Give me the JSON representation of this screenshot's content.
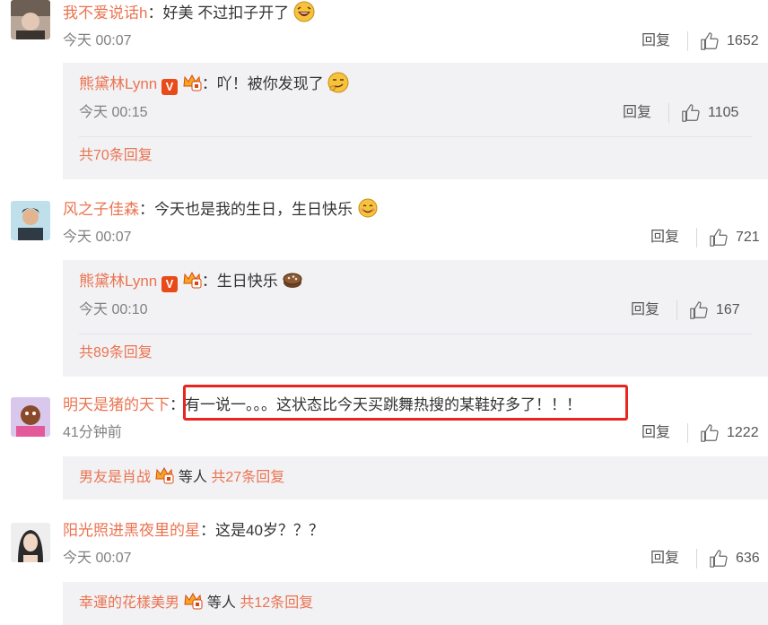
{
  "comments": [
    {
      "name": "我不爱说话h",
      "text": "好美 不过扣子开了",
      "time": "今天 00:07",
      "reply_label": "回复",
      "likes": "1652",
      "sub_reply": {
        "name": "熊黛林Lynn",
        "text": "吖！被你发现了",
        "time": "今天 00:15",
        "reply_label": "回复",
        "likes": "1105"
      },
      "more": "共70条回复"
    },
    {
      "name": "风之子佳森",
      "text": "今天也是我的生日，生日快乐",
      "time": "今天 00:07",
      "reply_label": "回复",
      "likes": "721",
      "sub_reply": {
        "name": "熊黛林Lynn",
        "text": "生日快乐",
        "time": "今天 00:10",
        "reply_label": "回复",
        "likes": "167"
      },
      "more": "共89条回复"
    },
    {
      "name": "明天是猪的天下",
      "text": "有一说一。。。这状态比今天买跳舞热搜的某鞋好多了！！！",
      "time": "41分钟前",
      "reply_label": "回复",
      "likes": "1222",
      "more_user": "男友是肖战",
      "more_mid": "等人",
      "more": "共27条回复"
    },
    {
      "name": "阳光照进黑夜里的星",
      "text": "这是40岁？？？",
      "time": "今天 00:07",
      "reply_label": "回复",
      "likes": "636",
      "more_user": "幸運的花樣美男",
      "more_mid": "等人",
      "more": "共12条回复"
    }
  ],
  "colon": "：",
  "colors": {
    "name": "#eb7350",
    "text": "#333333",
    "meta": "#808080",
    "sub_bg": "#f2f2f5",
    "highlight": "#e8251e"
  },
  "icons": [
    "laughing-emoji-icon",
    "smirk-emoji-icon",
    "smile-emoji-icon",
    "cake-emoji-icon",
    "thumb-up-icon",
    "verified-v-icon",
    "crown-badge-icon"
  ]
}
